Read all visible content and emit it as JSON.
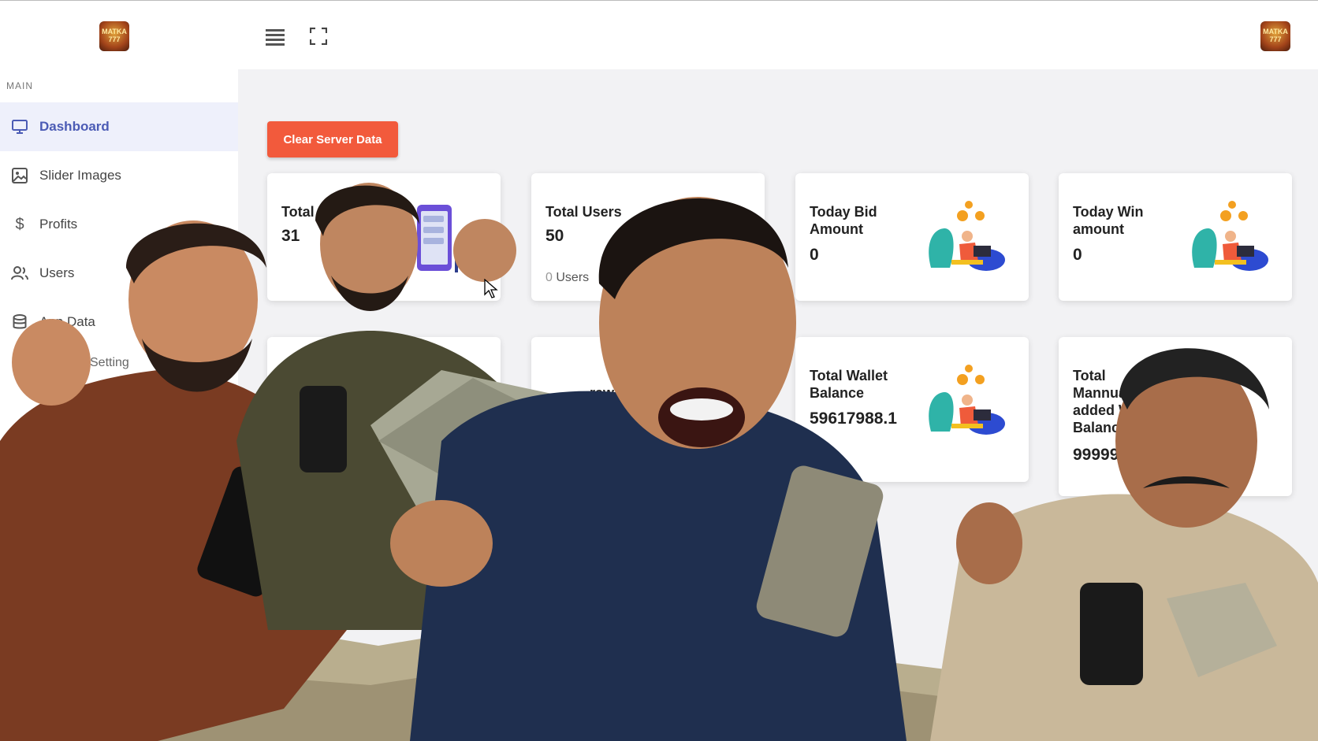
{
  "header": {
    "logo_text": "MATKA 777",
    "profile_logo_text": "MATKA 777",
    "menu_icon": "hamburger-menu-icon",
    "fullscreen_icon": "fullscreen-icon"
  },
  "sidebar": {
    "section_label": "MAIN",
    "items": [
      {
        "label": "Dashboard",
        "icon": "monitor-icon",
        "active": true
      },
      {
        "label": "Slider Images",
        "icon": "image-icon",
        "active": false
      },
      {
        "label": "Profits",
        "icon": "dollar-icon",
        "active": false
      },
      {
        "label": "Users",
        "icon": "users-icon",
        "active": false
      },
      {
        "label": "App Data",
        "icon": "database-icon",
        "active": false
      }
    ],
    "sub_item": "Setting"
  },
  "main": {
    "clear_button": "Clear Server Data",
    "cards": [
      {
        "title": "Total M",
        "value": "31"
      },
      {
        "title": "Total Users",
        "value": "50",
        "sub_value": "0",
        "sub_label": "Users"
      },
      {
        "title": "Today Bid Amount",
        "value": "0"
      },
      {
        "title": "Today Win amount",
        "value": "0"
      },
      {
        "title": "raw",
        "value": ""
      },
      {
        "title": "Total Wallet Balance",
        "value": "59617988.1"
      },
      {
        "title": "Total Mannual added W Balance",
        "value": "99999"
      }
    ]
  },
  "colors": {
    "accent": "#4b5bb5",
    "button": "#f25a3c",
    "active_bg": "#eef0fb"
  }
}
